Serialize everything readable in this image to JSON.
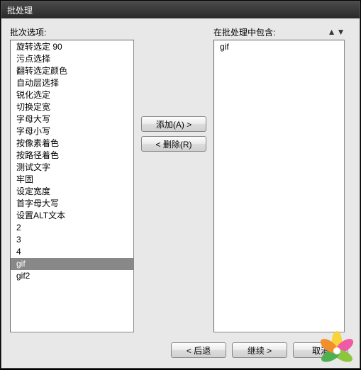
{
  "window": {
    "title": "批处理"
  },
  "left": {
    "label": "批次选项:",
    "items": [
      "旋转选定 90",
      "污点选择",
      "翻转选定颜色",
      "自动层选择",
      "锐化选定",
      "切换定宽",
      "字母大写",
      "字母小写",
      "按像素着色",
      "按路径着色",
      "测试文字",
      "牢固",
      "设定宽度",
      "首字母大写",
      "设置ALT文本",
      "2",
      "3",
      "4",
      "gif",
      "gif2"
    ],
    "selected_index": 18
  },
  "mid": {
    "add_label": "添加(A) >",
    "remove_label": "< 删除(R)"
  },
  "right": {
    "label": "在批处理中包含:",
    "items": [
      "gif"
    ],
    "selected_index": -1
  },
  "bottom": {
    "back_label": "< 后退",
    "continue_label": "继续 >",
    "cancel_label": "取消"
  },
  "icons": {
    "up": "▲",
    "down": "▼"
  }
}
